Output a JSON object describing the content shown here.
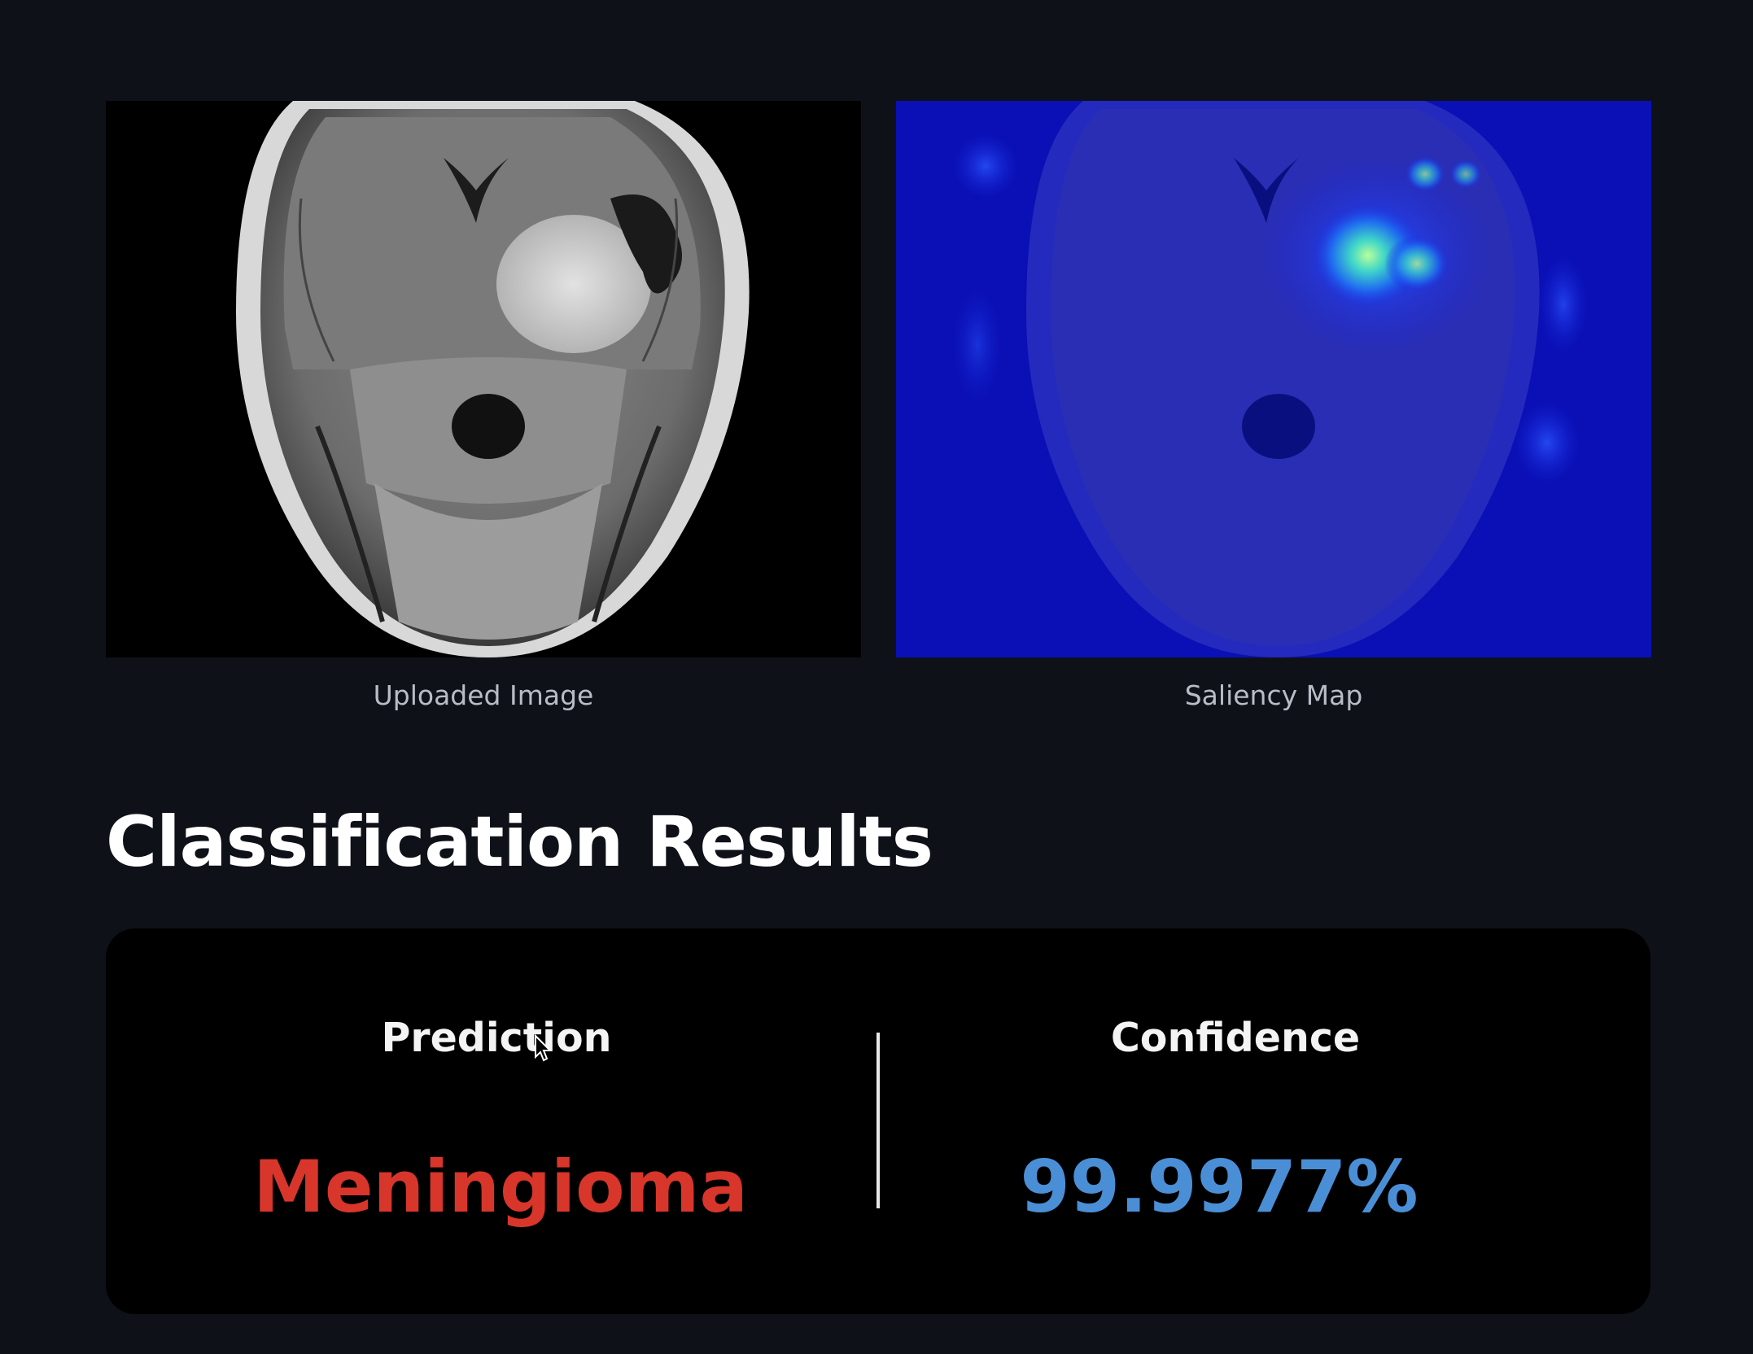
{
  "images": {
    "uploaded_caption": "Uploaded Image",
    "saliency_caption": "Saliency Map"
  },
  "results": {
    "heading": "Classification Results",
    "prediction_label": "Prediction",
    "prediction_value": "Meningioma",
    "confidence_label": "Confidence",
    "confidence_value": "99.9977%"
  },
  "colors": {
    "page_background": "#0e1118",
    "card_background": "#000000",
    "prediction_value": "#d8362a",
    "confidence_value": "#4a8fd6",
    "saliency_base": "#0a0fb8"
  }
}
